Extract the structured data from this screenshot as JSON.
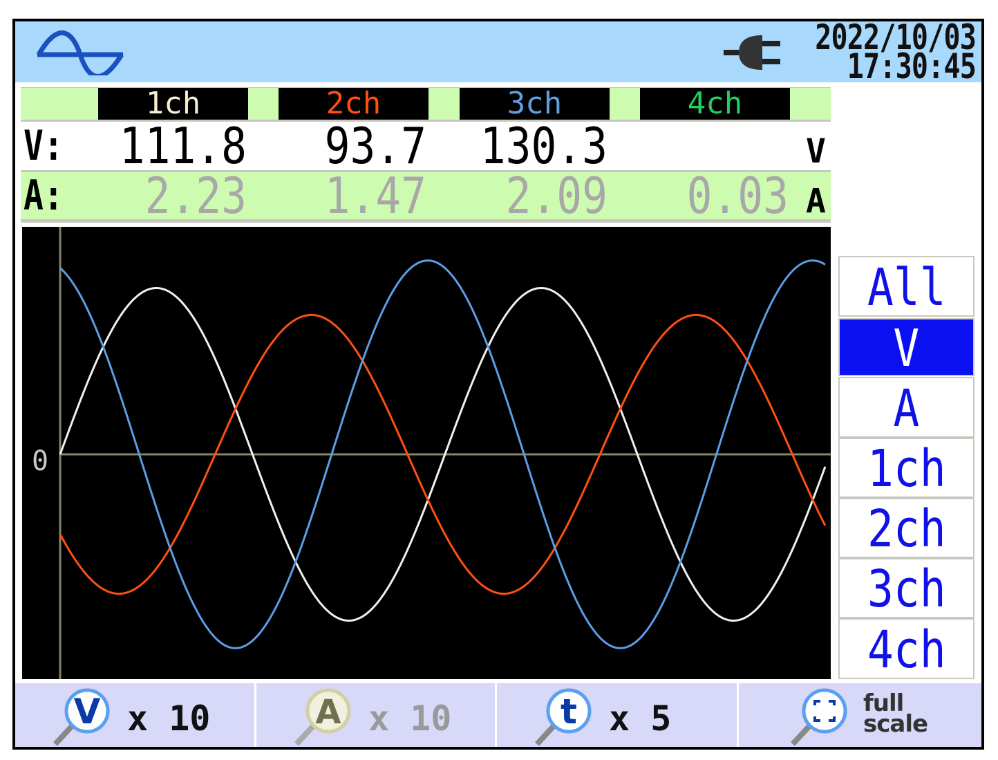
{
  "header": {
    "date": "2022/10/03",
    "time": "17:30:45",
    "mode_icon": "sine-wave-icon",
    "power_icon": "ac-plug-icon"
  },
  "table": {
    "channels": [
      {
        "label": "1ch",
        "color": "#f4f0d0",
        "voltage": "111.8",
        "current": "2.23"
      },
      {
        "label": "2ch",
        "color": "#ff5010",
        "voltage": "93.7",
        "current": "1.47"
      },
      {
        "label": "3ch",
        "color": "#60a0e0",
        "voltage": "130.3",
        "current": "2.09"
      },
      {
        "label": "4ch",
        "color": "#20d060",
        "voltage": "",
        "current": "0.03"
      }
    ],
    "v_label": "V:",
    "a_label": "A:",
    "v_unit": "V",
    "a_unit": "A"
  },
  "sidebar": {
    "items": [
      {
        "label": "All"
      },
      {
        "label": "V",
        "selected": true
      },
      {
        "label": "A"
      },
      {
        "label": "1ch"
      },
      {
        "label": "2ch"
      },
      {
        "label": "3ch"
      },
      {
        "label": "4ch"
      }
    ]
  },
  "toolbar": {
    "v_zoom": {
      "icon": "V",
      "label": "x 10"
    },
    "a_zoom": {
      "icon": "A",
      "label": "x 10",
      "disabled": true
    },
    "t_zoom": {
      "icon": "t",
      "label": "x 5"
    },
    "full": {
      "label1": "full",
      "label2": "scale"
    }
  },
  "chart_data": {
    "type": "line",
    "zero_label": "0",
    "ylim": [
      -152,
      152
    ],
    "cycles_shown": 1.99,
    "series": [
      {
        "name": "1ch",
        "color": "#f0f0f0",
        "amplitude": 111.8,
        "phase_deg": 0
      },
      {
        "name": "2ch",
        "color": "#ff5010",
        "amplitude": 93.7,
        "phase_deg": 215
      },
      {
        "name": "3ch",
        "color": "#5b9ee6",
        "amplitude": 130.3,
        "phase_deg": 106
      }
    ]
  }
}
